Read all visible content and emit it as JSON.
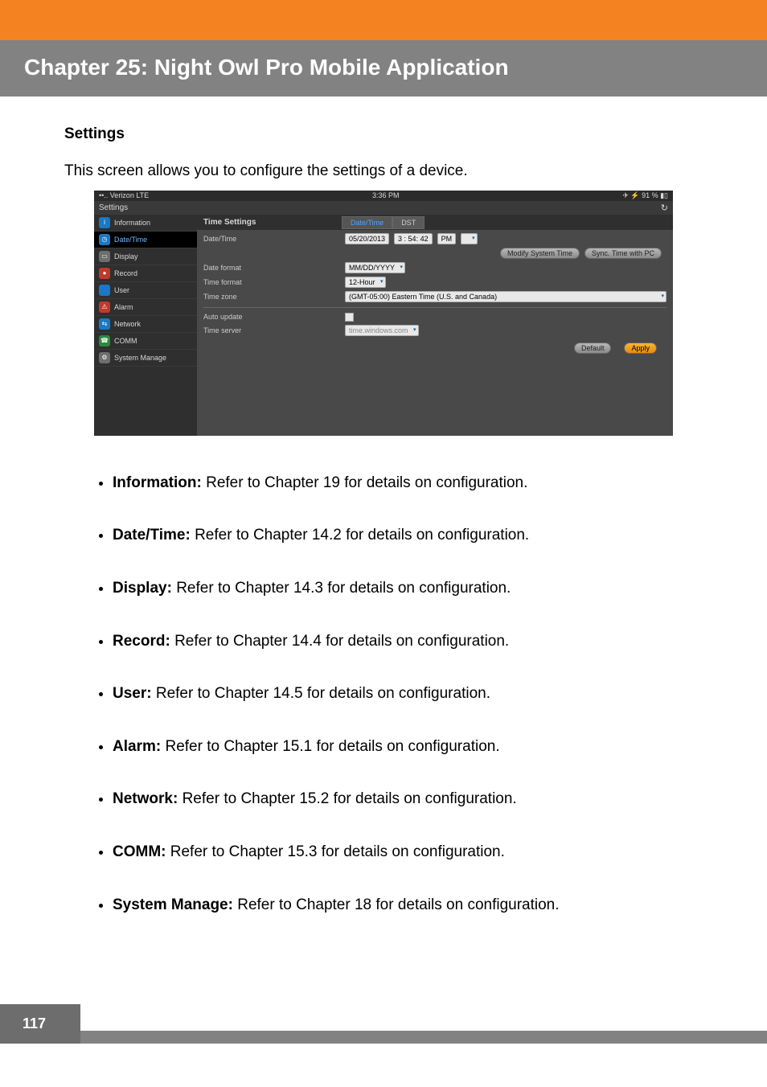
{
  "header": {
    "chapter_title": "Chapter 25: Night Owl Pro Mobile Application"
  },
  "section": {
    "heading": "Settings",
    "intro": "This screen allows you to configure the settings of a device."
  },
  "screenshot": {
    "status_left": "••.. Verizon  LTE",
    "status_time": "3:36 PM",
    "status_right": "✈ ⚡ 91 % ▮▯",
    "settings_title": "Settings",
    "refresh_glyph": "↻",
    "sidebar": [
      {
        "label": "Information",
        "active": false,
        "color": "blue",
        "glyph": "i"
      },
      {
        "label": "Date/Time",
        "active": true,
        "color": "blue",
        "glyph": "◷"
      },
      {
        "label": "Display",
        "active": false,
        "color": "gray",
        "glyph": "▭"
      },
      {
        "label": "Record",
        "active": false,
        "color": "red",
        "glyph": "●"
      },
      {
        "label": "User",
        "active": false,
        "color": "blue",
        "glyph": "👤"
      },
      {
        "label": "Alarm",
        "active": false,
        "color": "red",
        "glyph": "⚠"
      },
      {
        "label": "Network",
        "active": false,
        "color": "blue",
        "glyph": "⇆"
      },
      {
        "label": "COMM",
        "active": false,
        "color": "green",
        "glyph": "☎"
      },
      {
        "label": "System Manage",
        "active": false,
        "color": "gray",
        "glyph": "⚙"
      }
    ],
    "panel_title": "Time Settings",
    "tabs": {
      "datetime": "Date/Time",
      "dst": "DST"
    },
    "rows": {
      "datetime_label": "Date/Time",
      "date_value": "05/20/2013",
      "time_value": "3 : 54: 42",
      "ampm": "PM",
      "modify_btn": "Modify System Time",
      "sync_btn": "Sync. Time with PC",
      "date_format_label": "Date format",
      "date_format_value": "MM/DD/YYYY",
      "time_format_label": "Time format",
      "time_format_value": "12-Hour",
      "time_zone_label": "Time zone",
      "time_zone_value": "(GMT-05:00) Eastern Time (U.S. and Canada)",
      "auto_update_label": "Auto update",
      "time_server_label": "Time server",
      "time_server_value": "time.windows.com"
    },
    "buttons": {
      "default": "Default",
      "apply": "Apply"
    }
  },
  "bullets": [
    {
      "label": "Information:",
      "text": " Refer to Chapter 19 for details on configuration."
    },
    {
      "label": "Date/Time:",
      "text": " Refer to Chapter 14.2 for details on configuration."
    },
    {
      "label": "Display:",
      "text": " Refer to Chapter 14.3 for details on configuration."
    },
    {
      "label": "Record:",
      "text": " Refer to Chapter 14.4 for details on configuration."
    },
    {
      "label": "User:",
      "text": " Refer to Chapter 14.5 for details on configuration."
    },
    {
      "label": "Alarm:",
      "text": " Refer to Chapter 15.1 for details on configuration."
    },
    {
      "label": "Network:",
      "text": " Refer to Chapter 15.2 for details on configuration."
    },
    {
      "label": "COMM:",
      "text": " Refer to Chapter 15.3 for details on configuration."
    },
    {
      "label": "System Manage:",
      "text": " Refer to Chapter 18 for details on configuration."
    }
  ],
  "page_number": "117"
}
